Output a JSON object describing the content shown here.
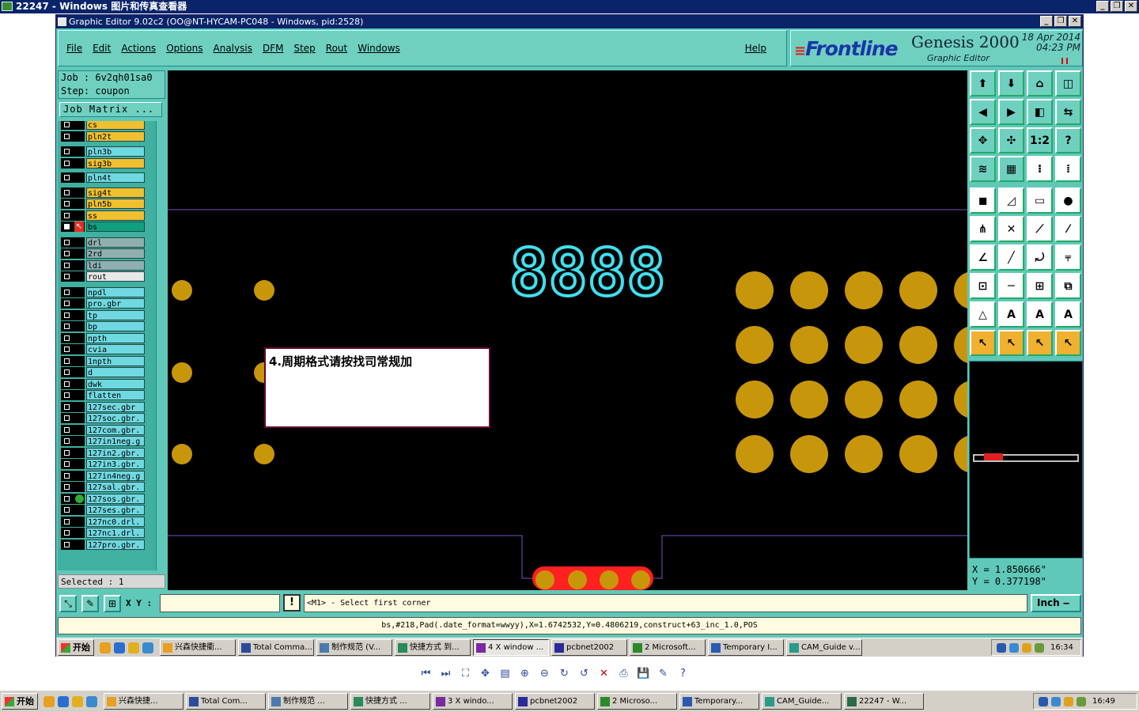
{
  "outer_window": {
    "title": "22247 - Windows 图片和传真查看器"
  },
  "app": {
    "title": "Graphic Editor 9.02c2  (OO@NT-HYCAM-PC048 - Windows, pid:2528)",
    "menu": [
      "File",
      "Edit",
      "Actions",
      "Options",
      "Analysis",
      "DFM",
      "Step",
      "Rout",
      "Windows"
    ],
    "help": "Help",
    "brand": {
      "logo": "Frontline",
      "product": "Genesis 2000",
      "subtitle": "Graphic Editor",
      "date": "18 Apr 2014",
      "time": "04:23 PM"
    },
    "job": "Job  :  6v2qh01sa0",
    "step": "Step:  coupon",
    "job_matrix": "Job Matrix ...",
    "layers": [
      {
        "name": "cs",
        "color": "#f0c030"
      },
      {
        "name": "pln2t",
        "color": "#f0c030"
      },
      {
        "name": "pln3b",
        "color": "#70d8e0"
      },
      {
        "name": "sig3b",
        "color": "#f0c030"
      },
      {
        "name": "pln4t",
        "color": "#70d8e0"
      },
      {
        "name": "sig4t",
        "color": "#f0c030"
      },
      {
        "name": "pln5b",
        "color": "#f0c030"
      },
      {
        "name": "ss",
        "color": "#f0c030"
      },
      {
        "name": "bs",
        "color": "#10a080"
      },
      {
        "name": "drl",
        "color": "#90b0b0"
      },
      {
        "name": "2rd",
        "color": "#90b0b0"
      },
      {
        "name": "ldi",
        "color": "#90b0b0"
      },
      {
        "name": "rout",
        "color": "#e8e8e8"
      },
      {
        "name": "npdl",
        "color": "#70d8e0"
      },
      {
        "name": "pro.gbr",
        "color": "#70d8e0"
      },
      {
        "name": "tp",
        "color": "#70d8e0"
      },
      {
        "name": "bp",
        "color": "#70d8e0"
      },
      {
        "name": "npth",
        "color": "#70d8e0"
      },
      {
        "name": "cvia",
        "color": "#70d8e0"
      },
      {
        "name": "1npth",
        "color": "#70d8e0"
      },
      {
        "name": "d",
        "color": "#70d8e0"
      },
      {
        "name": "dwk",
        "color": "#70d8e0"
      },
      {
        "name": "flatten",
        "color": "#70d8e0"
      },
      {
        "name": "127sec.gbr",
        "color": "#70d8e0"
      },
      {
        "name": "127soc.gbr.",
        "color": "#70d8e0"
      },
      {
        "name": "127com.gbr.",
        "color": "#70d8e0"
      },
      {
        "name": "127in1neg.g",
        "color": "#70d8e0"
      },
      {
        "name": "127in2.gbr.",
        "color": "#70d8e0"
      },
      {
        "name": "127in3.gbr.",
        "color": "#70d8e0"
      },
      {
        "name": "127in4neg.g",
        "color": "#70d8e0"
      },
      {
        "name": "127sal.gbr.",
        "color": "#70d8e0"
      },
      {
        "name": "127sos.gbr.",
        "color": "#70d8e0"
      },
      {
        "name": "127ses.gbr.",
        "color": "#70d8e0"
      },
      {
        "name": "127nc0.drl.",
        "color": "#70d8e0"
      },
      {
        "name": "127nc1.drl.",
        "color": "#70d8e0"
      },
      {
        "name": "127pro.gbr.",
        "color": "#70d8e0"
      }
    ],
    "selected": "Selected : 1",
    "canvas": {
      "readout": "8888",
      "note": "4.周期格式请按找司常规加"
    },
    "coords": {
      "x": "X = 1.850666\"",
      "y": "Y = 0.377198\""
    },
    "xy_label": "X Y :",
    "prompt": "<M1> - Select first corner",
    "unit": "Inch",
    "status": "bs,#218,Pad(.date_format=wwyy),X=1.6742532,Y=0.4806219,construct+63_inc_1.0,POS",
    "tool_icons": [
      "open-icon",
      "save-icon",
      "home-icon",
      "window-icon",
      "prev-icon",
      "next-icon",
      "fit-icon",
      "mirror-icon",
      "zoom-fit-icon",
      "zoom-center-icon",
      "scale-1-2-icon",
      "help-icon",
      "tools-icon",
      "grid-icon",
      "layers-icon",
      "layers-alt-icon",
      "snapshot-icon",
      "transform-icon",
      "ruler-icon",
      "dot-icon",
      "connect-icon",
      "cross-icon",
      "line-icon",
      "points-icon",
      "angle-icon",
      "slash-icon",
      "arc-icon",
      "mirror-f-icon",
      "node-icon",
      "dash-icon",
      "measure-icon",
      "group-icon",
      "text-a-icon",
      "text-a2-icon",
      "text-a3-icon",
      "text-a4-icon",
      "pointer-icon",
      "pointer-box-icon",
      "pointer-alt-icon",
      "pointer-multi-icon"
    ],
    "tool_labels": [
      "",
      "",
      "",
      "",
      "",
      "",
      "",
      "",
      "",
      "",
      "1:2",
      "?",
      "",
      "",
      "",
      "",
      "",
      "",
      "",
      "",
      "",
      "",
      "",
      "",
      "",
      "",
      "",
      "",
      "",
      "",
      "",
      "",
      "",
      "",
      "",
      "",
      "",
      "",
      "",
      ""
    ]
  },
  "inner_taskbar": {
    "start": "开始",
    "items": [
      "兴森快捷衢...",
      "Total Comma...",
      "制作规范 (V...",
      "快捷方式 到...",
      "4 X window ...",
      "pcbnet2002",
      "2 Microsoft...",
      "Temporary I...",
      "CAM_Guide v..."
    ],
    "clock": "16:34"
  },
  "outer_taskbar": {
    "start": "开始",
    "items": [
      "兴森快捷...",
      "Total Com...",
      "制作规范 ...",
      "快捷方式 ...",
      "3 X windo...",
      "pcbnet2002",
      "2 Microso...",
      "Temporary...",
      "CAM_Guide...",
      "22247 - W..."
    ],
    "clock": "16:49"
  }
}
